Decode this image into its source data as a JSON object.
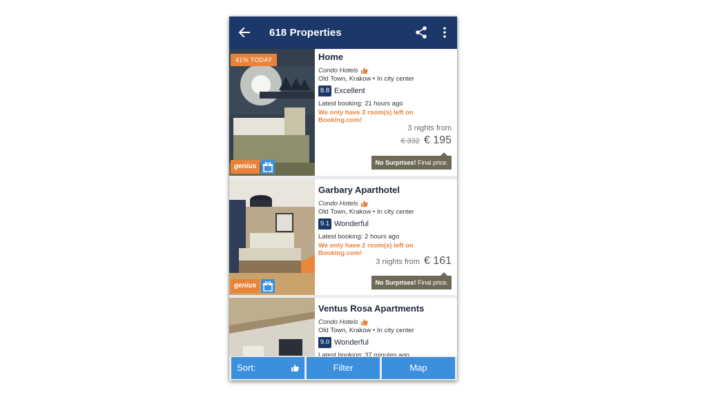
{
  "appbar": {
    "title": "618 Properties",
    "back_icon": "arrow-left-icon",
    "share_icon": "share-icon",
    "more_icon": "more-vertical-icon",
    "color": "#1b3869"
  },
  "properties": [
    {
      "deal_badge": "41% TODAY",
      "genius_label": "genius",
      "name": "Home",
      "category": "Condo Hotels",
      "location": "Old Town, Krakow • In city center",
      "score": "8.8",
      "score_word": "Excellent",
      "latest_booking": "Latest booking: 21 hours ago",
      "rooms_left": "We only have 3 room(s) left on Booking.com!",
      "nights": "3 nights from",
      "old_price": "€ 332",
      "price": "€ 195",
      "no_surprises_bold": "No Surprises!",
      "no_surprises_rest": " Final price."
    },
    {
      "genius_label": "genius",
      "name": "Garbary Aparthotel",
      "category": "Condo Hotels",
      "location": "Old Town, Krakow • In city center",
      "score": "9.1",
      "score_word": "Wonderful",
      "latest_booking": "Latest booking: 2 hours ago",
      "rooms_left": "We only have 2 room(s) left on Booking.com!",
      "nights": "3 nights from",
      "price": "€ 161",
      "no_surprises_bold": "No Surprises!",
      "no_surprises_rest": " Final price."
    },
    {
      "name": "Ventus Rosa Apartments",
      "category": "Condo Hotels",
      "location": "Old Town, Krakow • In city center",
      "score": "9.0",
      "score_word": "Wonderful",
      "latest_booking": "Latest booking: 37 minutes ago"
    }
  ],
  "bottom_bar": {
    "sort_label": "Sort:",
    "filter_label": "Filter",
    "map_label": "Map",
    "button_color": "#3c8fdc"
  },
  "colors": {
    "accent_orange": "#e8833a",
    "score_blue": "#1b3869",
    "no_surprises_bg": "#6e6a55"
  }
}
